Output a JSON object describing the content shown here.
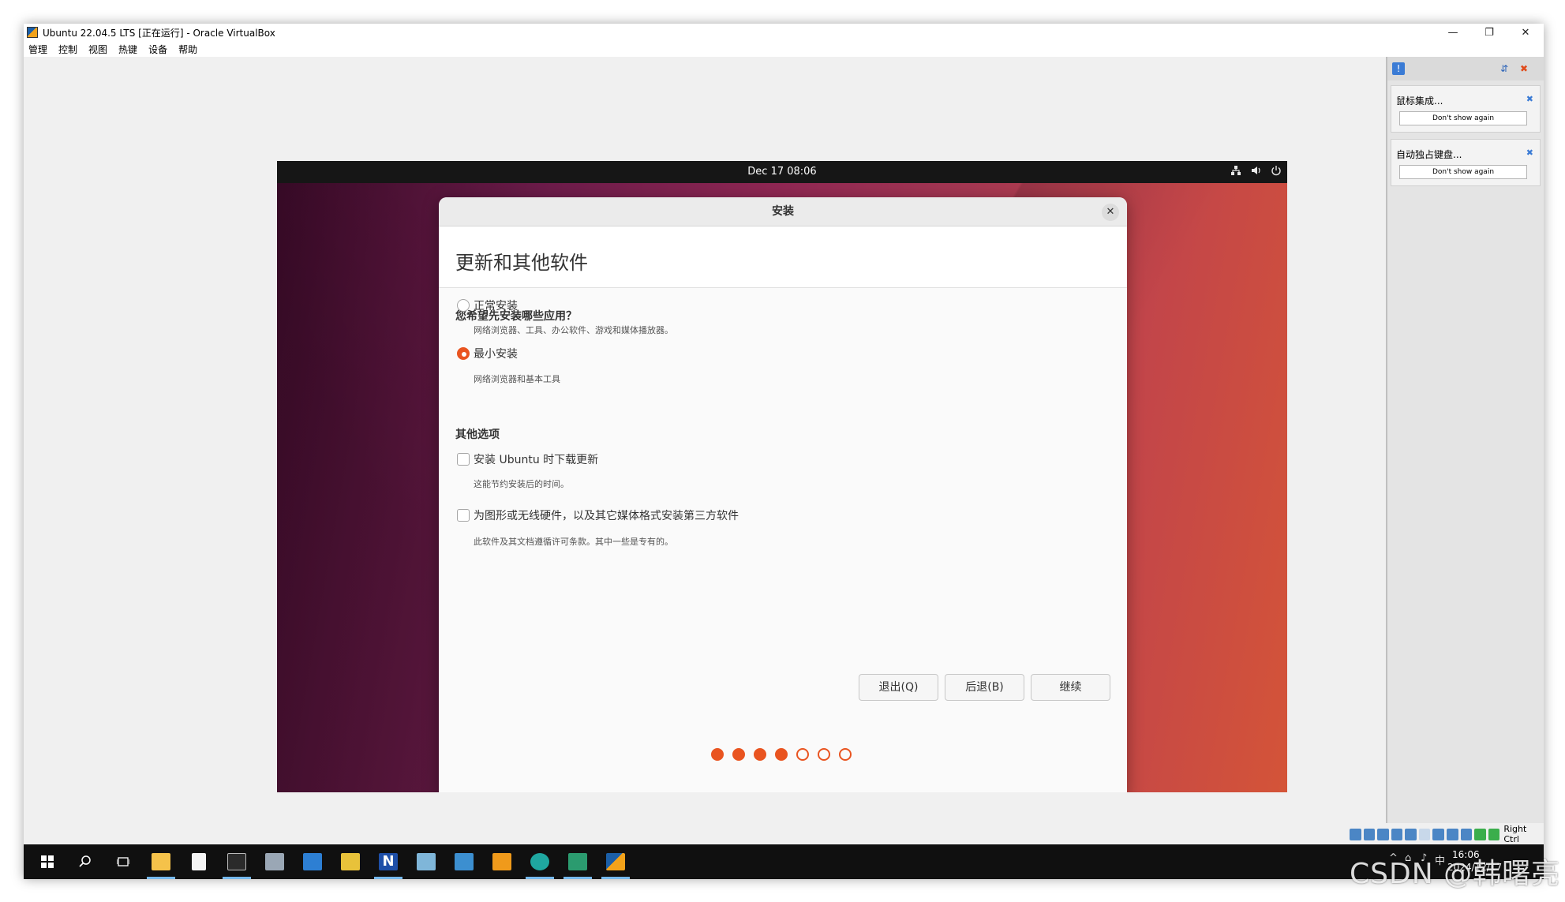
{
  "window": {
    "title": "Ubuntu 22.04.5 LTS [正在运行] - Oracle VirtualBox",
    "minimize_glyph": "—",
    "maximize_glyph": "❐",
    "close_glyph": "✕"
  },
  "menubar": {
    "items": [
      {
        "label": "管理"
      },
      {
        "label": "控制"
      },
      {
        "label": "视图"
      },
      {
        "label": "热键"
      },
      {
        "label": "设备"
      },
      {
        "label": "帮助"
      }
    ]
  },
  "ubuntu": {
    "clock": "Dec 17  08:06",
    "icons": {
      "network": "network-icon",
      "volume": "volume-icon",
      "power": "power-icon"
    }
  },
  "installer": {
    "window_title": "安装",
    "page_title": "更新和其他软件",
    "section_apps": "您希望先安装哪些应用？",
    "normal_label": "正常安装",
    "normal_desc": "网络浏览器、工具、办公软件、游戏和媒体播放器。",
    "minimal_label": "最小安装",
    "minimal_desc": "网络浏览器和基本工具",
    "selected_option": "minimal",
    "section_other": "其他选项",
    "updates_label": "安装 Ubuntu 时下载更新",
    "updates_desc": "这能节约安装后的时间。",
    "updates_checked": false,
    "thirdparty_label": "为图形或无线硬件，以及其它媒体格式安装第三方软件",
    "thirdparty_desc": "此软件及其文档遵循许可条款。其中一些是专有的。",
    "thirdparty_checked": false,
    "buttons": {
      "quit": "退出(Q)",
      "back": "后退(B)",
      "continue": "继续"
    },
    "progress": {
      "total_steps": 7,
      "completed_steps": 4
    },
    "accent_color": "#e95420"
  },
  "notifications": [
    {
      "text": "鼠标集成...",
      "button": "Don't show again"
    },
    {
      "text": "自动独占键盘...",
      "button": "Don't show again"
    }
  ],
  "vbox_status": {
    "host_key": "Right Ctrl"
  },
  "taskbar": {
    "time": "16:06",
    "date": "2024/12/17",
    "language": "中"
  },
  "watermark": "CSDN @韩曙亮"
}
